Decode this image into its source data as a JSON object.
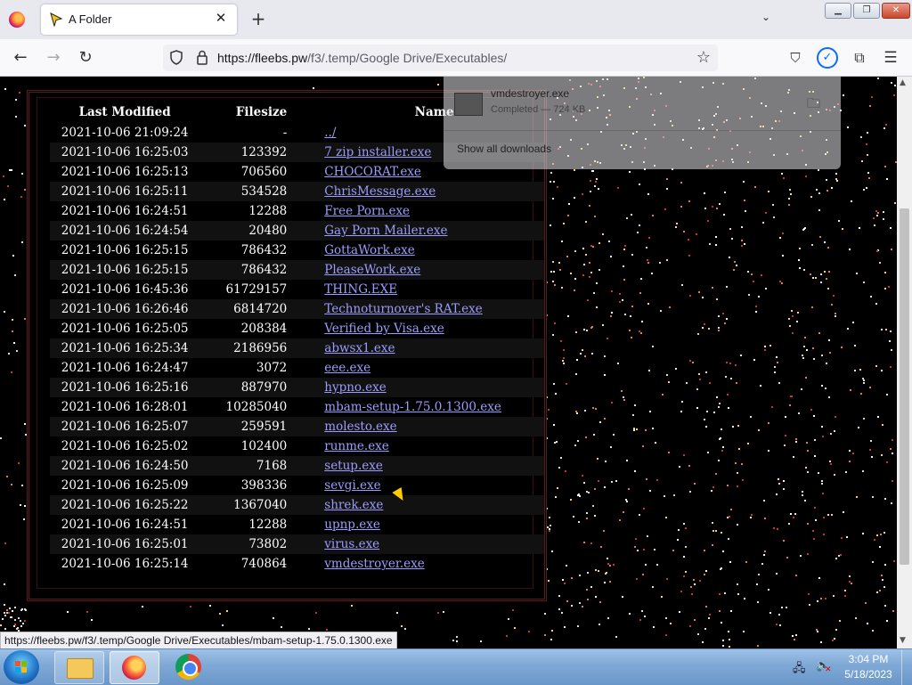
{
  "browser": {
    "tab_title": "A Folder",
    "tab_close": "✕",
    "new_tab": "+",
    "tab_list": "⌄",
    "url_host": "https://fleebs.pw",
    "url_path": "/f3/.temp/Google Drive/Executables/",
    "status_link": "https://fleebs.pw/f3/.temp/Google Drive/Executables/mbam-setup-1.75.0.1300.exe",
    "icons": [
      "firefox-icon",
      "back-icon",
      "forward-icon",
      "reload-icon",
      "shield-icon",
      "lock-icon",
      "star-icon",
      "pocket-icon",
      "download-icon",
      "extensions-icon",
      "menu-icon"
    ]
  },
  "downloads": {
    "file_name": "vmdestroyer.exe",
    "status": "Completed — 724 KB",
    "show_all": "Show all downloads"
  },
  "listing": {
    "headers": {
      "modified": "Last Modified",
      "size": "Filesize",
      "name": "Name"
    },
    "rows": [
      {
        "modified": "2021-10-06 21:09:24",
        "size": "-",
        "name": "../"
      },
      {
        "modified": "2021-10-06 16:25:03",
        "size": "123392",
        "name": "7 zip installer.exe"
      },
      {
        "modified": "2021-10-06 16:25:13",
        "size": "706560",
        "name": "CHOCORAT.exe"
      },
      {
        "modified": "2021-10-06 16:25:11",
        "size": "534528",
        "name": "ChrisMessage.exe"
      },
      {
        "modified": "2021-10-06 16:24:51",
        "size": "12288",
        "name": "Free Porn.exe"
      },
      {
        "modified": "2021-10-06 16:24:54",
        "size": "20480",
        "name": "Gay Porn Mailer.exe"
      },
      {
        "modified": "2021-10-06 16:25:15",
        "size": "786432",
        "name": "GottaWork.exe"
      },
      {
        "modified": "2021-10-06 16:25:15",
        "size": "786432",
        "name": "PleaseWork.exe"
      },
      {
        "modified": "2021-10-06 16:45:36",
        "size": "61729157",
        "name": "THING.EXE"
      },
      {
        "modified": "2021-10-06 16:26:46",
        "size": "6814720",
        "name": "Technoturnover's RAT.exe"
      },
      {
        "modified": "2021-10-06 16:25:05",
        "size": "208384",
        "name": "Verified by Visa.exe"
      },
      {
        "modified": "2021-10-06 16:25:34",
        "size": "2186956",
        "name": "abwsx1.exe"
      },
      {
        "modified": "2021-10-06 16:24:47",
        "size": "3072",
        "name": "eee.exe"
      },
      {
        "modified": "2021-10-06 16:25:16",
        "size": "887970",
        "name": "hypno.exe"
      },
      {
        "modified": "2021-10-06 16:28:01",
        "size": "10285040",
        "name": "mbam-setup-1.75.0.1300.exe"
      },
      {
        "modified": "2021-10-06 16:25:07",
        "size": "259591",
        "name": "molesto.exe"
      },
      {
        "modified": "2021-10-06 16:25:02",
        "size": "102400",
        "name": "runme.exe"
      },
      {
        "modified": "2021-10-06 16:24:50",
        "size": "7168",
        "name": "setup.exe"
      },
      {
        "modified": "2021-10-06 16:25:09",
        "size": "398336",
        "name": "sevgi.exe"
      },
      {
        "modified": "2021-10-06 16:25:22",
        "size": "1367040",
        "name": "shrek.exe"
      },
      {
        "modified": "2021-10-06 16:24:51",
        "size": "12288",
        "name": "upnp.exe"
      },
      {
        "modified": "2021-10-06 16:25:01",
        "size": "73802",
        "name": "virus.exe"
      },
      {
        "modified": "2021-10-06 16:25:14",
        "size": "740864",
        "name": "vmdestroyer.exe"
      }
    ]
  },
  "taskbar": {
    "time": "3:04 PM",
    "date": "5/18/2023",
    "items": [
      "windows-explorer",
      "firefox",
      "chrome"
    ]
  },
  "colors": {
    "link": "#9c9cff",
    "background": "#000000",
    "frame": "#5a1a1a"
  }
}
